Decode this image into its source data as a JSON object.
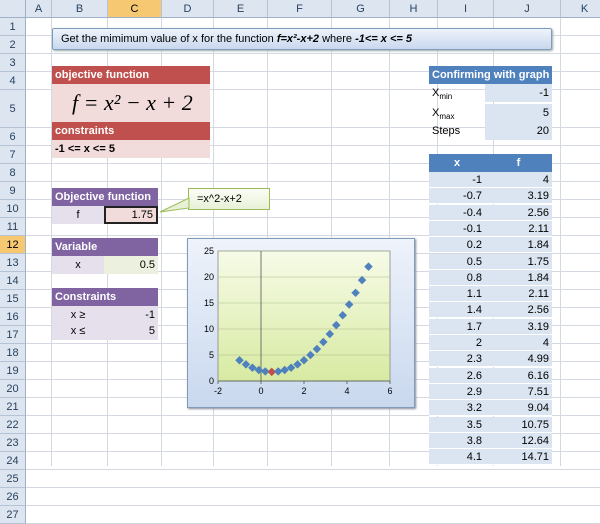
{
  "columns": [
    "A",
    "B",
    "C",
    "D",
    "E",
    "F",
    "G",
    "H",
    "I",
    "J",
    "K"
  ],
  "rows": [
    "1",
    "2",
    "3",
    "4",
    "5",
    "6",
    "7",
    "8",
    "9",
    "10",
    "11",
    "12",
    "13",
    "14",
    "15",
    "16",
    "17",
    "18",
    "19",
    "20",
    "21",
    "22",
    "23",
    "24",
    "25",
    "26",
    "27"
  ],
  "banner": {
    "text_pre": "Get the mimimum value of x for the function ",
    "text_func": "f=x²-x+2",
    "text_mid": "  where ",
    "text_range": "-1<= x <= 5"
  },
  "objective": {
    "header": "objective function",
    "formula": "f = x² − x + 2",
    "constraints_header": "constraints",
    "constraints_text": "-1 <= x <= 5"
  },
  "objective_table": {
    "header": "Objective function",
    "label": "f",
    "value": "1.75",
    "formula_note": "=x^2-x+2"
  },
  "variable_table": {
    "header": "Variable",
    "label": "x",
    "value": "0.5"
  },
  "constraints_table": {
    "header": "Constraints",
    "rows": [
      {
        "label": "x ≥",
        "value": "-1"
      },
      {
        "label": "x ≤",
        "value": "5"
      }
    ]
  },
  "confirm": {
    "header": "Confirming with graph",
    "xmin_label": "X",
    "xmin_sub": "min",
    "xmin_value": "-1",
    "xmax_label": "X",
    "xmax_sub": "max",
    "xmax_value": "5",
    "steps_label": "Steps",
    "steps_value": "20"
  },
  "data_table": {
    "headers": [
      "x",
      "f"
    ],
    "rows": [
      [
        "-1",
        "4"
      ],
      [
        "-0.7",
        "3.19"
      ],
      [
        "-0.4",
        "2.56"
      ],
      [
        "-0.1",
        "2.11"
      ],
      [
        "0.2",
        "1.84"
      ],
      [
        "0.5",
        "1.75"
      ],
      [
        "0.8",
        "1.84"
      ],
      [
        "1.1",
        "2.11"
      ],
      [
        "1.4",
        "2.56"
      ],
      [
        "1.7",
        "3.19"
      ],
      [
        "2",
        "4"
      ],
      [
        "2.3",
        "4.99"
      ],
      [
        "2.6",
        "6.16"
      ],
      [
        "2.9",
        "7.51"
      ],
      [
        "3.2",
        "9.04"
      ],
      [
        "3.5",
        "10.75"
      ],
      [
        "3.8",
        "12.64"
      ],
      [
        "4.1",
        "14.71"
      ]
    ]
  },
  "colors": {
    "marker": "#4f81bd",
    "min_marker": "#c0504d",
    "plot_bg_top": "#f7fbe8",
    "plot_bg_bottom": "#d7eaa1"
  },
  "chart_data": {
    "type": "scatter",
    "series": [
      {
        "x": [
          -1,
          -0.7,
          -0.4,
          -0.1,
          0.2,
          0.5,
          0.8,
          1.1,
          1.4,
          1.7,
          2,
          2.3,
          2.6,
          2.9,
          3.2,
          3.5,
          3.8,
          4.1,
          4.4,
          4.7,
          5
        ],
        "y": [
          4,
          3.19,
          2.56,
          2.11,
          1.84,
          1.75,
          1.84,
          2.11,
          2.56,
          3.19,
          4,
          4.99,
          6.16,
          7.51,
          9.04,
          10.75,
          12.64,
          14.71,
          16.96,
          19.39,
          22
        ]
      }
    ],
    "highlight": {
      "x": 0.5,
      "y": 1.75
    },
    "xlim": [
      -2,
      6
    ],
    "ylim": [
      0,
      25
    ],
    "xticks": [
      "-2",
      "0",
      "2",
      "4",
      "6"
    ],
    "yticks": [
      "0",
      "5",
      "10",
      "15",
      "20",
      "25"
    ],
    "grid": true
  }
}
